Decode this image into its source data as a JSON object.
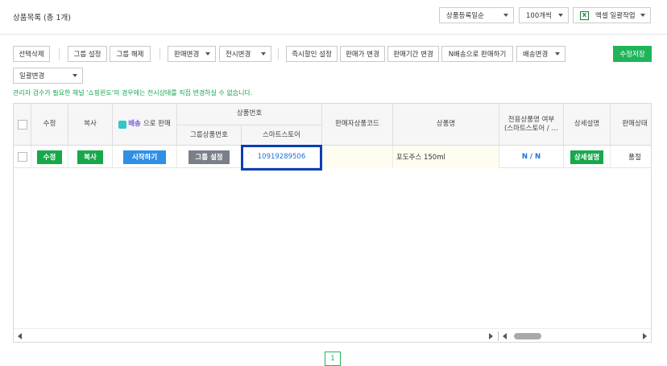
{
  "page": {
    "title": "상품목록",
    "count": "(총 1개)"
  },
  "top_controls": {
    "sort": "상품등록일순",
    "per_page": "100개씩",
    "excel": "엑셀 일괄작업"
  },
  "toolbar": {
    "delete": "선택삭제",
    "group_set": "그룹 설정",
    "group_unset": "그룹 해제",
    "sale_change": "판매변경",
    "display_change": "전시변경",
    "instant_discount": "즉시할인 설정",
    "price_change": "판매가 변경",
    "period_change": "판매기간 변경",
    "n_delivery": "N배송으로 판매하기",
    "delivery_change": "배송변경",
    "save": "수정저장",
    "bulk_change": "일괄변경"
  },
  "notice": "관리자 검수가 필요한 채널 '쇼핑윈도'의 경우에는 전시상태를 직접 변경하실 수 없습니다.",
  "table": {
    "headers": {
      "edit": "수정",
      "copy": "복사",
      "badge": "배송",
      "sell_with": "으로 판매",
      "product_number": "상품번호",
      "group_number": "그룹상품번호",
      "smartstore": "스마트스토어",
      "seller_code": "판매자상품코드",
      "product_name": "상품명",
      "exclusive_line1": "전용상품명 여부",
      "exclusive_line2": "(스마트스토어 / …",
      "detail": "상세설명",
      "sale_status": "판매상태"
    },
    "rows": [
      {
        "edit": "수정",
        "copy": "복사",
        "start": "시작하기",
        "group": "그룹 설정",
        "smartstore_no": "10919289506",
        "seller_code": "",
        "name": "포도주스 150ml",
        "exclusive": "N / N",
        "detail": "상세설명",
        "status": "품절"
      }
    ]
  },
  "pagination": {
    "current": "1"
  },
  "colors": {
    "accent_green": "#1fb45a",
    "link_blue": "#1e6fd9",
    "highlight_border": "#0a3fb4"
  }
}
